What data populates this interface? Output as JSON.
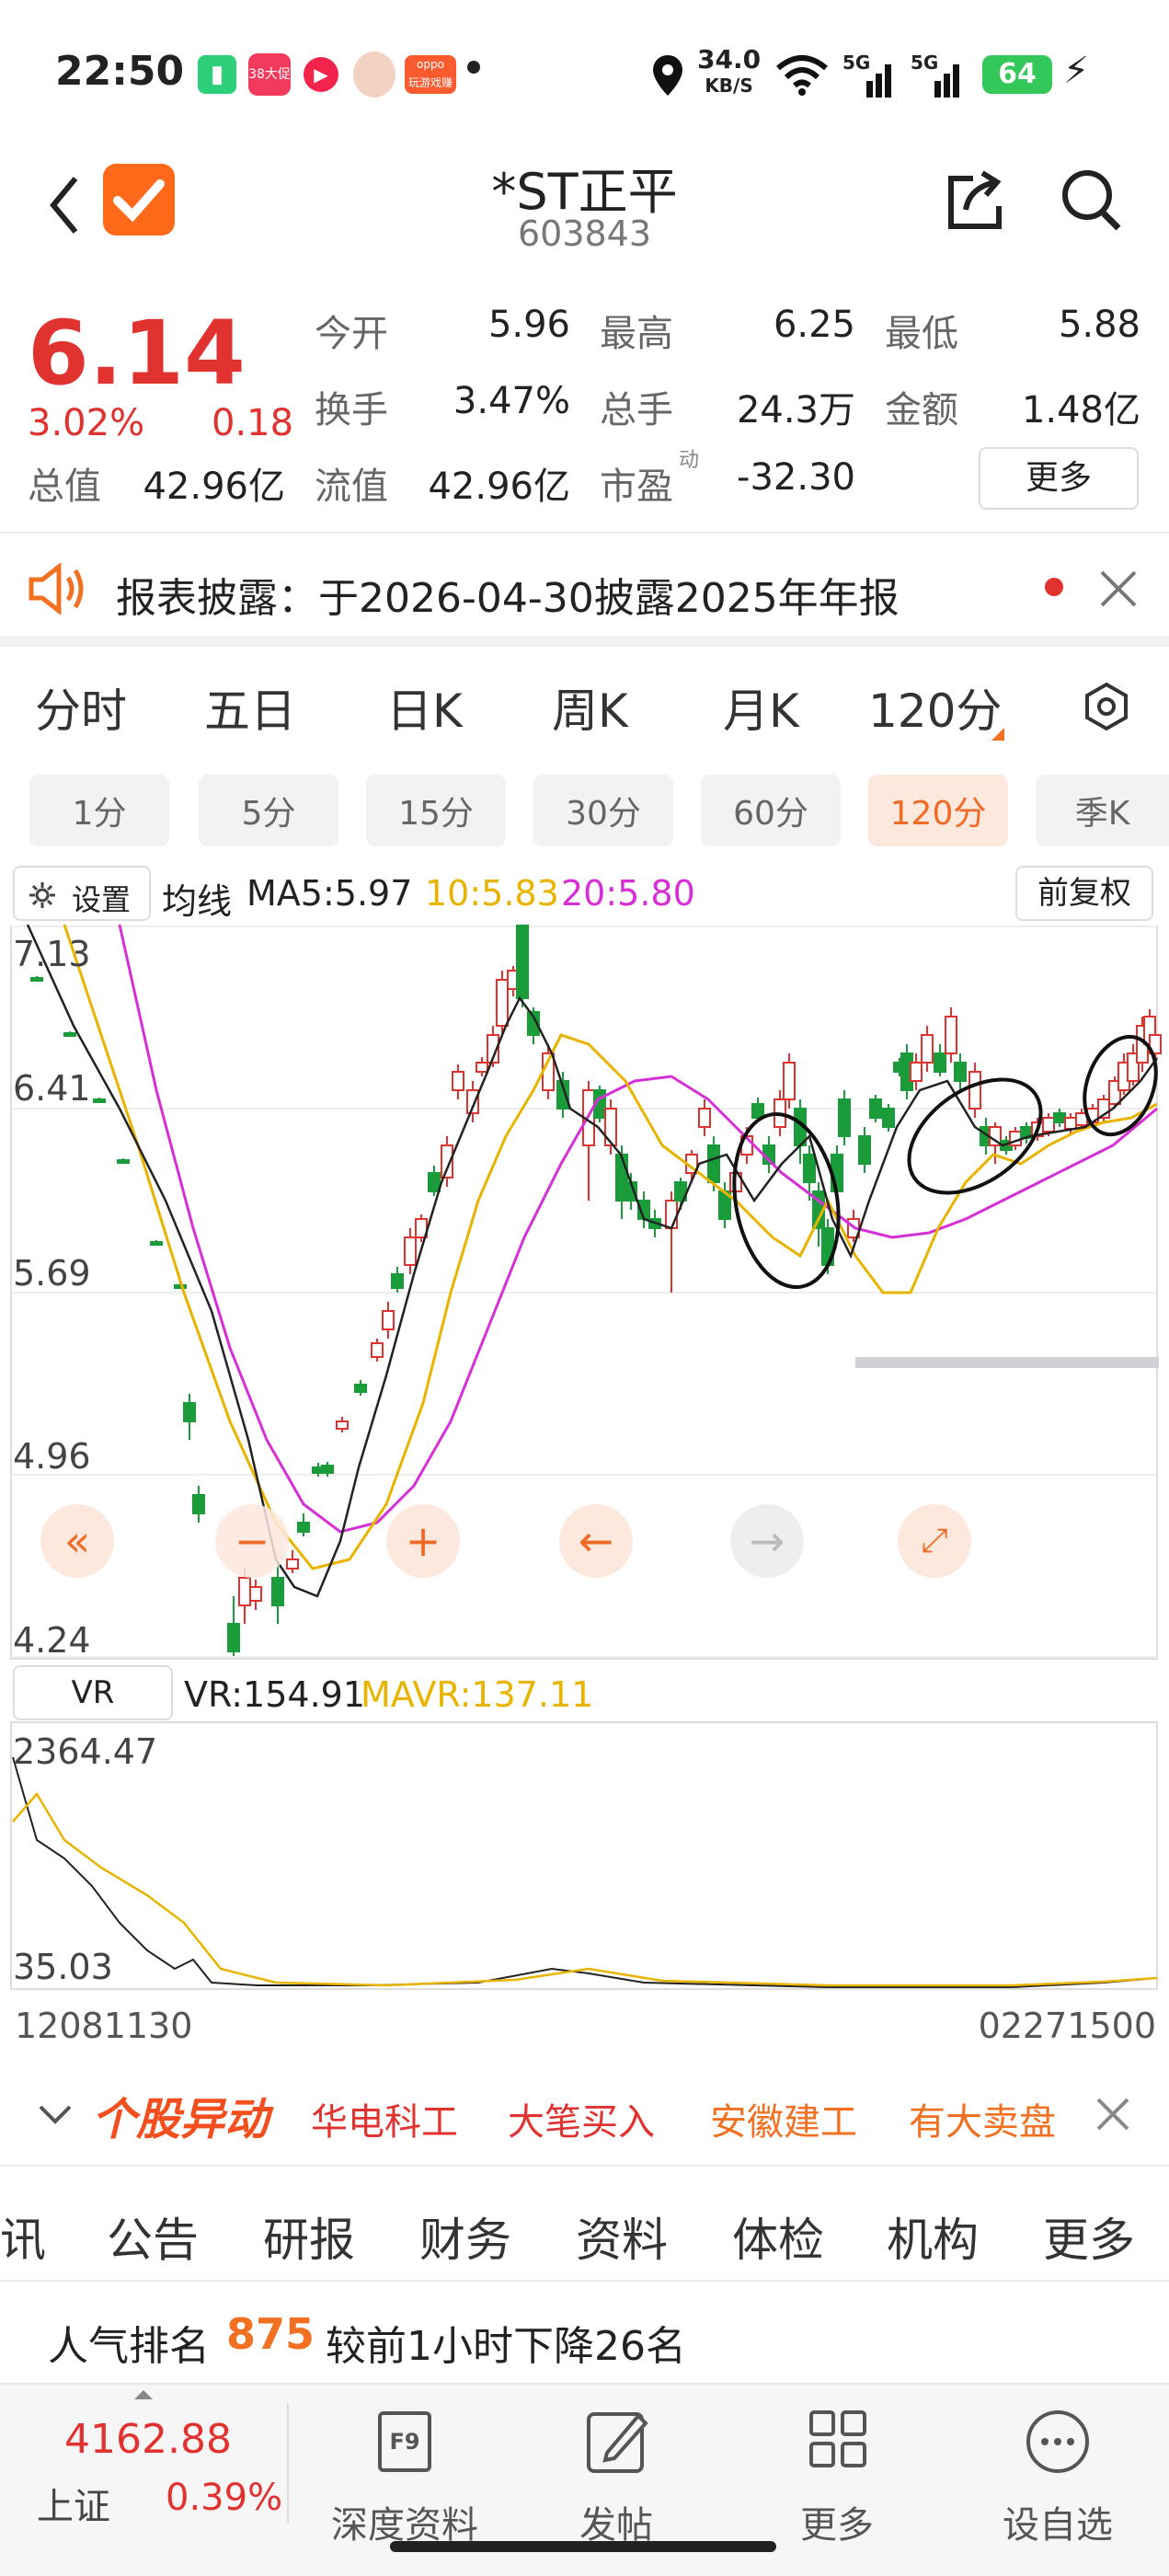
{
  "status": {
    "time": "22:50",
    "net_speed": "34.0",
    "net_unit": "KB/S",
    "sig1": "5G",
    "sig2": "5G",
    "battery": "64",
    "app_tiny1": "38大促",
    "app_tiny2": "oppo",
    "app_tiny3": "玩游戏赚币"
  },
  "nav": {
    "title": "*ST正平",
    "code": "603843"
  },
  "quote": {
    "price": "6.14",
    "pct": "3.02%",
    "change": "0.18",
    "open_label": "今开",
    "open": "5.96",
    "high_label": "最高",
    "high": "6.25",
    "low_label": "最低",
    "low": "5.88",
    "turnover_label": "换手",
    "turnover": "3.47%",
    "volume_label": "总手",
    "volume": "24.3万",
    "amount_label": "金额",
    "amount": "1.48亿",
    "total_label": "总值",
    "total": "42.96亿",
    "float_label": "流值",
    "float": "42.96亿",
    "pe_label": "市盈",
    "pe_sup": "动",
    "pe": "-32.30",
    "more": "更多"
  },
  "notice": {
    "text": "报表披露：于2026-04-30披露2025年年报"
  },
  "tabs": [
    "分时",
    "五日",
    "日K",
    "周K",
    "月K",
    "120分"
  ],
  "subtabs": [
    "1分",
    "5分",
    "15分",
    "30分",
    "60分",
    "120分",
    "季K"
  ],
  "chart_head": {
    "settings": "设置",
    "ma_label": "均线",
    "ma5": "MA5:5.97",
    "ma10": "10:5.83",
    "ma20": "20:5.80",
    "adjust": "前复权"
  },
  "chart_data": {
    "type": "candlestick",
    "y_ticks": [
      "7.13",
      "6.41",
      "5.69",
      "4.96",
      "4.24"
    ],
    "ylim": [
      4.24,
      7.13
    ],
    "series": [
      {
        "name": "MA5",
        "value": 5.97,
        "color": "#222222"
      },
      {
        "name": "MA10",
        "value": 5.83,
        "color": "#e8b400"
      },
      {
        "name": "MA20",
        "value": 5.8,
        "color": "#d62fd6"
      }
    ],
    "volume_indicator": {
      "name": "VR",
      "value": 154.91,
      "mavr": 137.11,
      "y_ticks": [
        "2364.47",
        "35.03"
      ]
    },
    "x_range": [
      "12081130",
      "02271500"
    ]
  },
  "vr": {
    "btn": "VR",
    "vr": "VR:154.91",
    "mavr": "MAVR:137.11",
    "top": "2364.47",
    "bottom": "35.03"
  },
  "dates": {
    "start": "12081130",
    "end": "02271500"
  },
  "alerts": {
    "logo": "个股异动",
    "items": [
      "华电科工",
      "大笔买入",
      "安徽建工",
      "有大卖盘"
    ]
  },
  "info_tabs": [
    "讯",
    "公告",
    "研报",
    "财务",
    "资料",
    "体检",
    "机构",
    "更多"
  ],
  "popular": {
    "label": "人气排名",
    "rank": "875",
    "desc": "较前1小时下降26名"
  },
  "bottom": {
    "index_value": "4162.88",
    "index_name": "上证",
    "index_pct": "0.39%",
    "items": [
      "深度资料",
      "发帖",
      "更多",
      "设自选"
    ]
  }
}
